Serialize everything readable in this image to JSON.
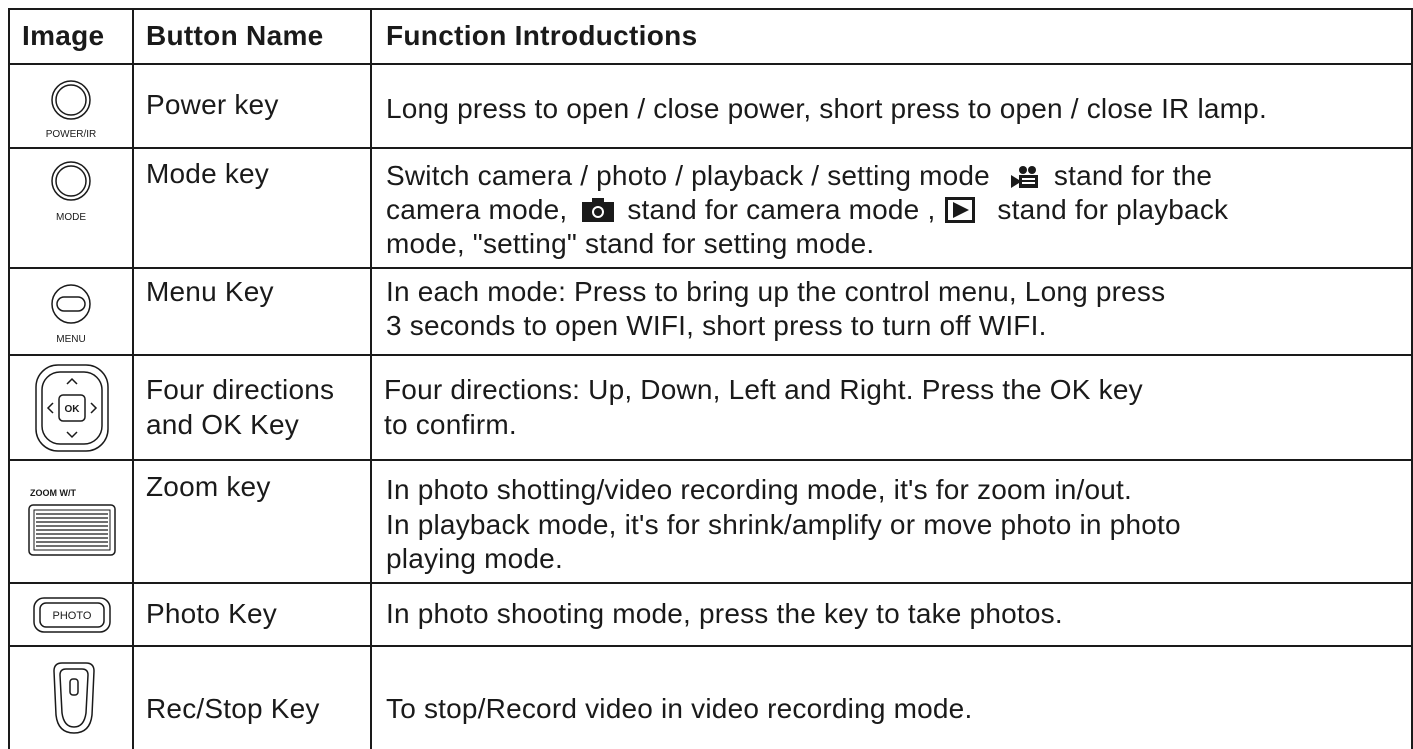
{
  "header": {
    "col_image": "Image",
    "col_button": "Button Name",
    "col_function": "Function Introductions"
  },
  "rows": [
    {
      "icon_name": "power-button-icon",
      "icon_label": "POWER/IR",
      "name_lines": [
        "Power key"
      ],
      "function_lines": [
        "Long press to open / close power, short press to open / close IR lamp."
      ]
    },
    {
      "icon_name": "mode-button-icon",
      "icon_label": "MODE",
      "name_lines": [
        "Mode key"
      ],
      "function": {
        "line1": "Switch camera / photo / playback / setting mode",
        "line1_end": "stand for the",
        "line2_start": "camera mode,",
        "line2_mid": "stand for camera mode ,",
        "line2_end": "stand for playback",
        "line3": "mode, \"setting\" stand for setting mode.",
        "icons": [
          "video-camera-icon",
          "photo-camera-icon",
          "play-icon"
        ]
      }
    },
    {
      "icon_name": "menu-button-icon",
      "icon_label": "MENU",
      "name_lines": [
        "Menu Key"
      ],
      "function_lines": [
        "In each mode: Press to bring up the control menu, Long press",
        "3 seconds to open WIFI, short press to turn off WIFI."
      ]
    },
    {
      "icon_name": "dpad-ok-icon",
      "icon_label": "OK",
      "name_lines": [
        "Four directions",
        "and OK Key"
      ],
      "function_lines": [
        "Four directions: Up, Down, Left and Right. Press the OK key",
        "to confirm."
      ]
    },
    {
      "icon_name": "zoom-rocker-icon",
      "icon_label": "ZOOM W/T",
      "name_lines": [
        "Zoom key"
      ],
      "function_lines": [
        "In photo shotting/video recording mode, it's for zoom in/out.",
        "In playback mode, it's for shrink/amplify or move photo in photo",
        "playing mode."
      ]
    },
    {
      "icon_name": "photo-button-icon",
      "icon_label": "PHOTO",
      "name_lines": [
        "Photo Key"
      ],
      "function_lines": [
        "In photo shooting mode, press the key to take photos."
      ]
    },
    {
      "icon_name": "rec-stop-button-icon",
      "icon_label": "",
      "name_lines": [
        "Rec/Stop Key"
      ],
      "function_lines": [
        "To stop/Record video in video recording mode."
      ]
    }
  ]
}
